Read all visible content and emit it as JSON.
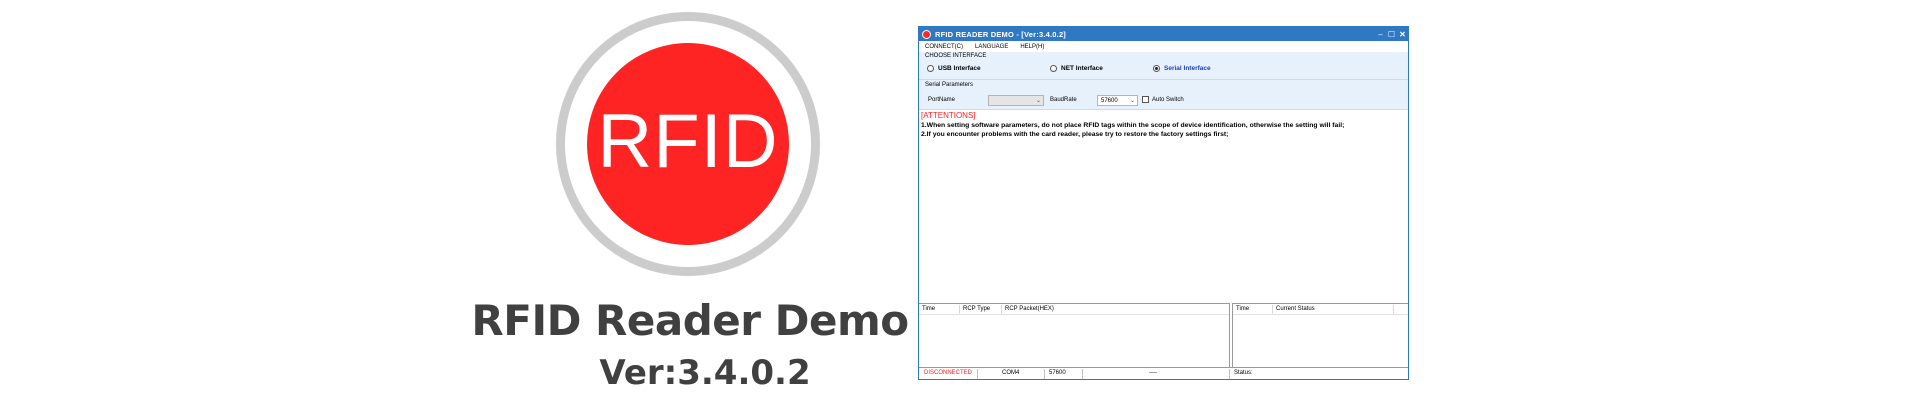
{
  "brand": {
    "logo_text": "RFID",
    "title": "RFID Reader Demo",
    "version": "Ver:3.4.0.2"
  },
  "window": {
    "title": "RFID READER DEMO - [Ver:3.4.0.2]",
    "controls": {
      "minimize": "–",
      "maximize": "☐",
      "close": "✕"
    }
  },
  "menu": [
    "CONNECT(C)",
    "LANGUAGE",
    "HELP(H)"
  ],
  "interface": {
    "legend": "CHOOSE INTERFACE",
    "options": [
      "USB Interface",
      "NET Interface",
      "Serial Interface"
    ],
    "selected": "Serial Interface"
  },
  "serial": {
    "legend": "Serial Parameters",
    "port_label": "PortName",
    "port_value": "",
    "baud_label": "BaudRate",
    "baud_value": "57600",
    "auto_switch_label": "Auto Switch",
    "auto_switch_checked": false
  },
  "attentions": {
    "heading": "[ATTENTIONS]",
    "line1": "1.When setting software parameters, do not place RFID tags within the scope of device identification, otherwise the setting will fail;",
    "line2": "2.If you encounter problems with the card reader, please try to restore the factory settings first;"
  },
  "packet_log": {
    "columns": [
      "Time",
      "RCP Type",
      "RCP Packet(HEX)"
    ]
  },
  "status_log": {
    "columns": [
      "Time",
      "Current Status"
    ]
  },
  "statusbar": {
    "connection": "DISCONNECTED",
    "port": "COM4",
    "baud": "57600",
    "extra": "----",
    "status": "Status:"
  },
  "colors": {
    "logo_red": "#ff2424",
    "logo_ring": "#cccccc",
    "titlebar": "#2f78c4",
    "panel_bg": "#e6f1fb",
    "alert_red": "#ff2020",
    "selected_blue": "#1f3fbf"
  }
}
